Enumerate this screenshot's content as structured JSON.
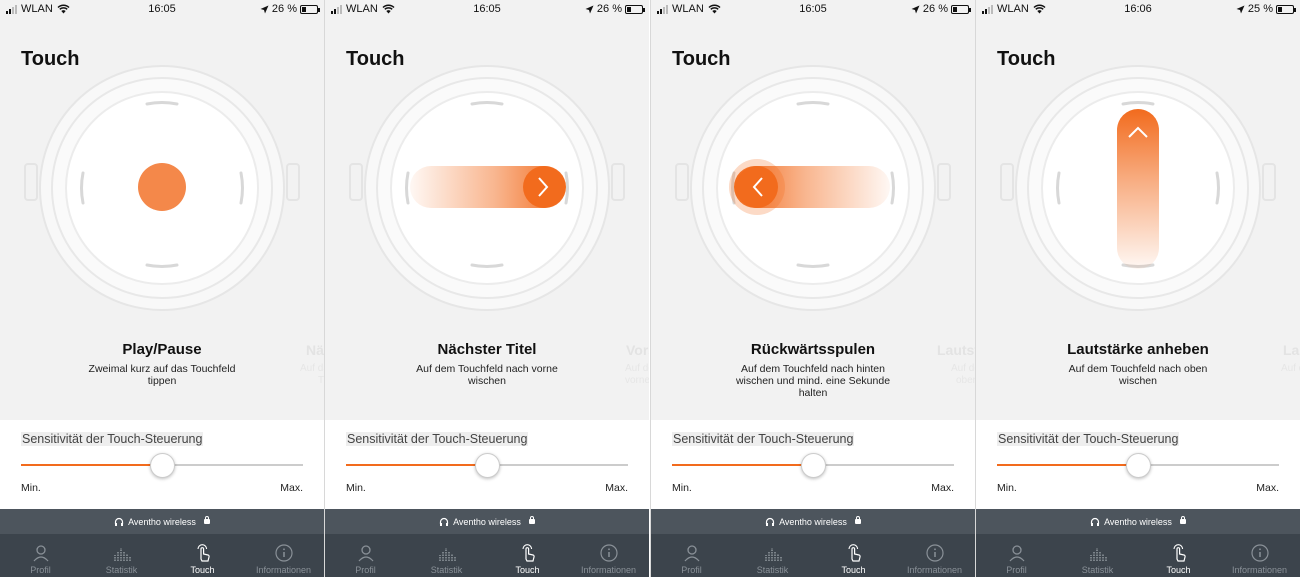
{
  "screens": [
    {
      "status": {
        "carrier": "WLAN",
        "time": "16:05",
        "battery": "26 %"
      },
      "title": "Touch",
      "gesture": "tap",
      "function_title": "Play/Pause",
      "function_desc": "Zweimal kurz auf das Touchfeld tippen",
      "next_title": "Näc",
      "next_desc": "Auf das",
      "next_desc2": "T",
      "sensitivity_label": "Sensitivität der Touch-Steuerung",
      "sensitivity_value": 0.5,
      "min_label": "Min.",
      "max_label": "Max.",
      "device": "Aventho wireless"
    },
    {
      "status": {
        "carrier": "WLAN",
        "time": "16:05",
        "battery": "26 %"
      },
      "title": "Touch",
      "gesture": "swipe-forward",
      "function_title": "Nächster Titel",
      "function_desc": "Auf dem Touchfeld nach vorne wischen",
      "next_title": "Vorsp",
      "next_desc": "Auf dem T",
      "next_desc2": "vorne w",
      "sensitivity_label": "Sensitivität der Touch-Steuerung",
      "sensitivity_value": 0.5,
      "min_label": "Min.",
      "max_label": "Max.",
      "device": "Aventho wireless"
    },
    {
      "status": {
        "carrier": "WLAN",
        "time": "16:05",
        "battery": "26 %"
      },
      "title": "Touch",
      "gesture": "swipe-back",
      "function_title": "Rückwärtsspulen",
      "function_desc": "Auf dem Touchfeld nach hinten wischen und mind. eine Sekunde halten",
      "next_title": "Lautst",
      "next_desc": "Auf dem T",
      "next_desc2": "oben w",
      "sensitivity_label": "Sensitivität der Touch-Steuerung",
      "sensitivity_value": 0.5,
      "min_label": "Min.",
      "max_label": "Max.",
      "device": "Aventho wireless"
    },
    {
      "status": {
        "carrier": "WLAN",
        "time": "16:06",
        "battery": "25 %"
      },
      "title": "Touch",
      "gesture": "swipe-up",
      "function_title": "Lautstärke anheben",
      "function_desc": "Auf dem Touchfeld nach oben wischen",
      "next_title": "Laut",
      "next_desc": "Auf d",
      "next_desc2": "",
      "sensitivity_label": "Sensitivität der Touch-Steuerung",
      "sensitivity_value": 0.5,
      "min_label": "Min.",
      "max_label": "Max.",
      "device": "Aventho wireless"
    }
  ],
  "tabs": [
    {
      "label": "Profil",
      "icon": "profile-icon"
    },
    {
      "label": "Statistik",
      "icon": "statistics-icon"
    },
    {
      "label": "Touch",
      "icon": "touch-icon",
      "active": true
    },
    {
      "label": "Informationen",
      "icon": "info-icon"
    }
  ],
  "colors": {
    "accent": "#f26b1d",
    "bar": "#4d555d",
    "tabbar": "#3c444c"
  }
}
